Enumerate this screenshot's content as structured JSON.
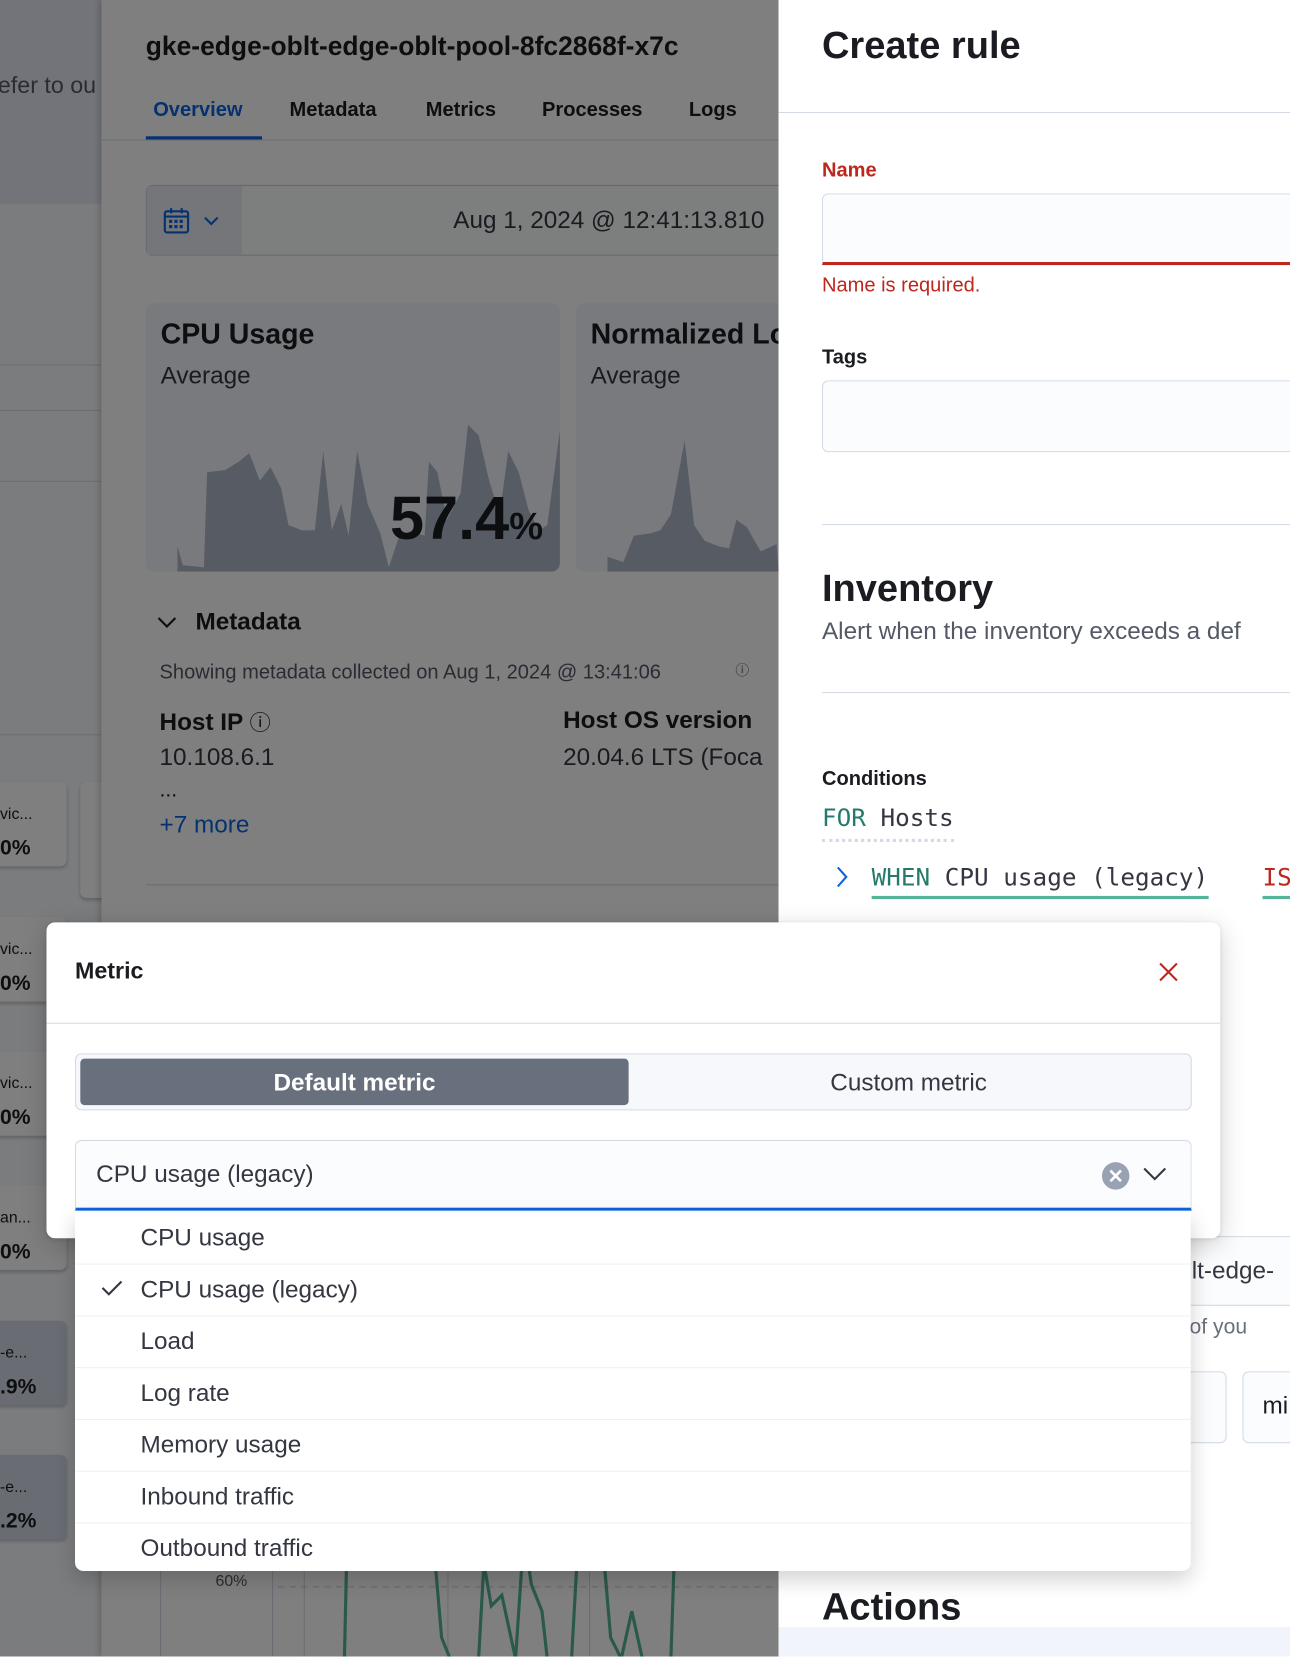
{
  "background_page": {
    "partial_text": "efer to ou",
    "cards": [
      {
        "label": "vic...",
        "value": "0%"
      },
      {
        "label": "vic...",
        "value": "0%"
      },
      {
        "label": "vic...",
        "value": "0%"
      },
      {
        "label": "an...",
        "value": "0%"
      },
      {
        "label": "-e...",
        "value": ".9%"
      },
      {
        "label": "-e...",
        "value": ".2%"
      }
    ]
  },
  "host_flyout": {
    "title": "gke-edge-oblt-edge-oblt-pool-8fc2868f-x7c",
    "tabs": [
      {
        "label": "Overview",
        "active": true
      },
      {
        "label": "Metadata"
      },
      {
        "label": "Metrics"
      },
      {
        "label": "Processes"
      },
      {
        "label": "Logs"
      }
    ],
    "date": "Aug 1, 2024 @ 12:41:13.810",
    "kpis": [
      {
        "title": "CPU Usage",
        "subtitle": "Average",
        "value": "57.4",
        "unit": "%"
      },
      {
        "title": "Normalized Lo",
        "subtitle": "Average"
      }
    ],
    "metadata": {
      "heading": "Metadata",
      "collected": "Showing metadata collected on Aug 1, 2024 @ 13:41:06",
      "fields": [
        {
          "label": "Host IP",
          "value": "10.108.6.1",
          "extra": "...",
          "more": "+7 more"
        },
        {
          "label": "Host OS version",
          "value": "20.04.6 LTS (Foca"
        }
      ]
    },
    "chart_tick": "60%"
  },
  "create_rule": {
    "title": "Create rule",
    "name_label": "Name",
    "name_value": "",
    "name_error": "Name is required.",
    "tags_label": "Tags",
    "rule_type": "Inventory",
    "rule_desc": "Alert when the inventory exceeds a def",
    "conditions_label": "Conditions",
    "for_keyword": "FOR",
    "for_value": "Hosts",
    "when_keyword": "WHEN",
    "when_value": "CPU usage (legacy)",
    "is_keyword": "IS",
    "filter_partial": "lt-edge-",
    "help_partial": "ope of you",
    "unit_partial": "mi",
    "actions_heading": "Actions"
  },
  "metric_popover": {
    "title": "Metric",
    "toggle": {
      "default": "Default metric",
      "custom": "Custom metric",
      "selected": "default"
    },
    "selected_value": "CPU usage (legacy)",
    "options": [
      {
        "label": "CPU usage",
        "checked": false
      },
      {
        "label": "CPU usage (legacy)",
        "checked": true
      },
      {
        "label": "Load",
        "checked": false
      },
      {
        "label": "Log rate",
        "checked": false
      },
      {
        "label": "Memory usage",
        "checked": false
      },
      {
        "label": "Inbound traffic",
        "checked": false
      },
      {
        "label": "Outbound traffic",
        "checked": false
      }
    ]
  },
  "colors": {
    "accent": "#0b64dd",
    "danger": "#bd271e",
    "teal": "#54b399",
    "keyword": "#267a6b",
    "toggle_selected": "#69707d"
  }
}
